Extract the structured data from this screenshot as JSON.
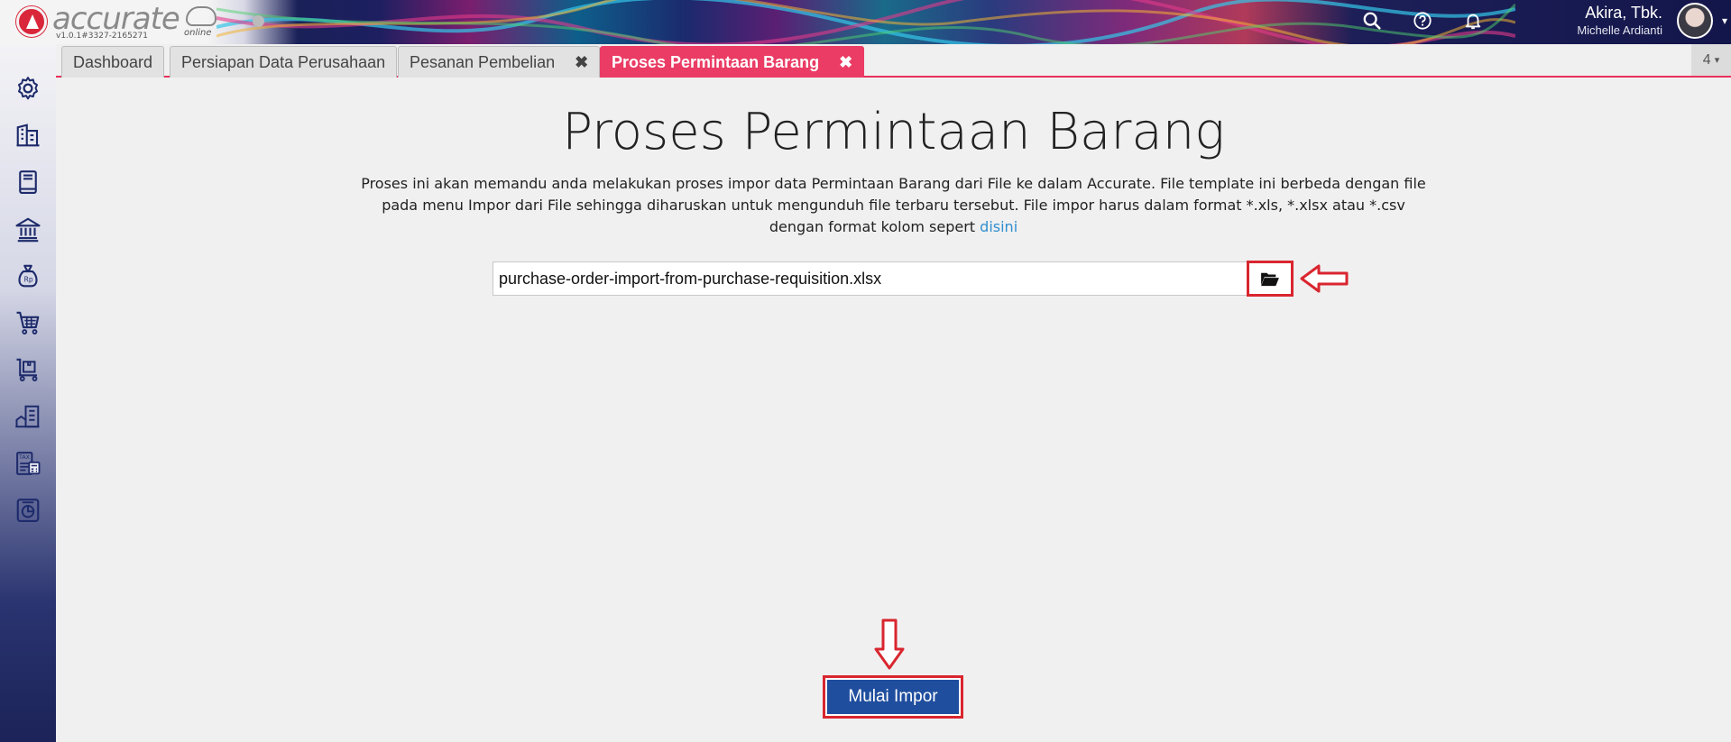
{
  "header": {
    "logo_word": "accurate",
    "logo_online": "online",
    "version": "v1.0.1#3327-2165271",
    "user_name": "Akira, Tbk.",
    "user_sub": "Michelle Ardianti",
    "icons": [
      "search-icon",
      "help-icon",
      "bell-icon"
    ]
  },
  "sidebar": {
    "icons": [
      "gear-icon",
      "building-icon",
      "book-icon",
      "bank-icon",
      "money-bag-icon",
      "cart-icon",
      "delivery-cart-icon",
      "warehouse-icon",
      "tax-icon",
      "report-icon"
    ]
  },
  "tabs": [
    {
      "label": "Dashboard",
      "closable": false,
      "active": false
    },
    {
      "label": "Persiapan Data Perusahaan",
      "closable": false,
      "active": false
    },
    {
      "label": "Pesanan Pembelian",
      "closable": true,
      "active": false
    },
    {
      "label": "Proses Permintaan Barang",
      "closable": true,
      "active": true
    }
  ],
  "tab_close_glyph": "✖",
  "tab_count": "4",
  "main": {
    "title": "Proses Permintaan Barang",
    "description": "Proses ini akan memandu anda melakukan proses impor data Permintaan Barang dari File ke dalam Accurate. File template ini berbeda dengan file pada menu Impor dari File sehingga diharuskan untuk mengunduh file terbaru tersebut. File impor harus dalam format *.xls, *.xlsx atau *.csv dengan format kolom sepert",
    "link_text": "disini",
    "file_value": "purchase-order-import-from-purchase-requisition.xlsx",
    "start_button": "Mulai Impor"
  },
  "colors": {
    "accent": "#ea3c64",
    "primary_button": "#1f4e9e",
    "annotation_red": "#d9262f",
    "link": "#2f8ed0"
  }
}
